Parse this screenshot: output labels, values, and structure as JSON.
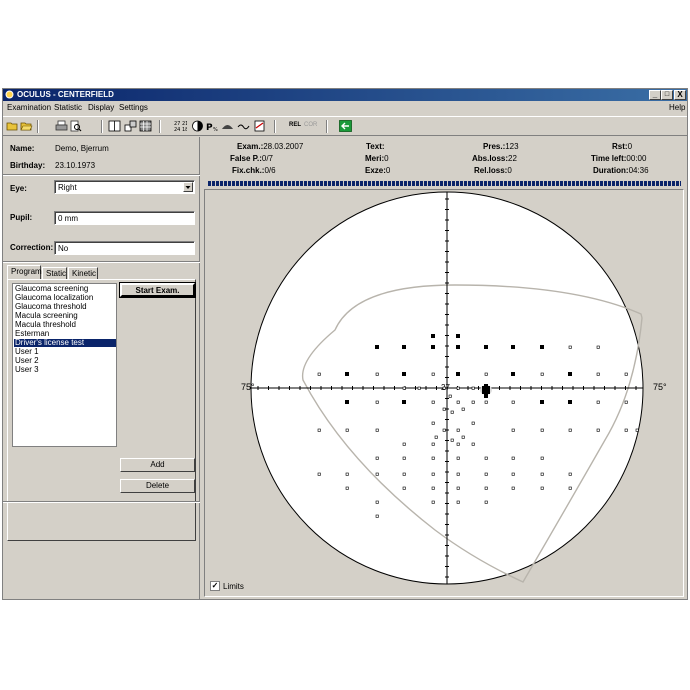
{
  "window": {
    "title": "OCULUS - CENTERFIELD",
    "minimize": "_",
    "maximize": "□",
    "close": "X"
  },
  "menu": {
    "items": [
      "Examination",
      "Statistic",
      "Display",
      "Settings"
    ],
    "help": "Help"
  },
  "toolbar": {
    "rel_label": "REL",
    "cor_label": "COR"
  },
  "patient": {
    "name_label": "Name:",
    "name": "Demo, Bjerrum",
    "birthday_label": "Birthday:",
    "birthday": "23.10.1973",
    "eye_label": "Eye:",
    "eye": "Right",
    "pupil_label": "Pupil:",
    "pupil": "0 mm",
    "correction_label": "Correction:",
    "correction": "No"
  },
  "tabs": [
    "Program",
    "Static",
    "Kinetic"
  ],
  "programs": [
    "Glaucoma screening",
    "Glaucoma localization",
    "Glaucoma threshold",
    "Macula screening",
    "Macula threshold",
    "Esterman",
    "Driver's license test",
    "User 1",
    "User 2",
    "User 3"
  ],
  "selected_program": "Driver's license test",
  "buttons": {
    "start": "Start Exam.",
    "add": "Add",
    "delete": "Delete"
  },
  "exam": {
    "exam_label": "Exam.:",
    "exam_date": "28.03.2007",
    "text_label": "Text:",
    "text": "",
    "pres_label": "Pres.:",
    "pres": "123",
    "rst_label": "Rst:",
    "rst": "0",
    "falsep_label": "False P.:",
    "falsep": "0/7",
    "meri_label": "Meri:",
    "meri": "0",
    "absloss_label": "Abs.loss:",
    "absloss": "22",
    "timeleft_label": "Time left:",
    "timeleft": "00:00",
    "fixchk_label": "Fix.chk.:",
    "fixchk": "0/6",
    "exze_label": "Exze:",
    "exze": "0",
    "relloss_label": "Rel.loss:",
    "relloss": "0",
    "duration_label": "Duration:",
    "duration": "04:36"
  },
  "field": {
    "left_label": "75°",
    "right_label": "75°",
    "center_value": "27",
    "limits_label": "Limits",
    "limits_checked": true,
    "check_mark": "✓"
  }
}
